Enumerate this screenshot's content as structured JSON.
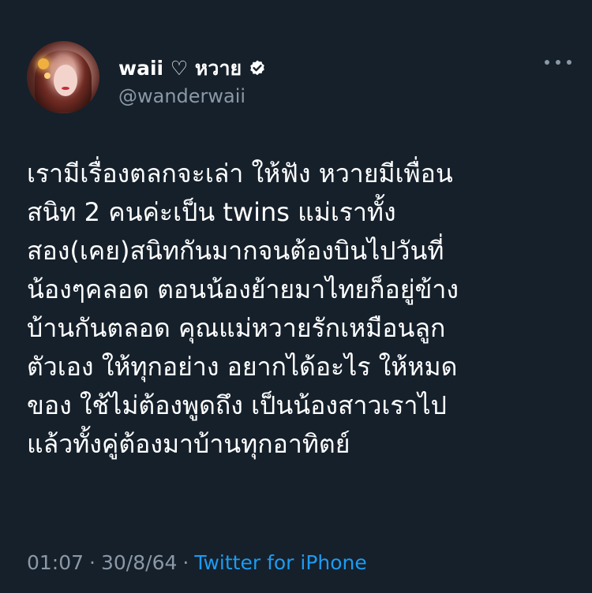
{
  "tweet": {
    "author": {
      "display_name": "waii ♡ หวาย",
      "handle": "@wanderwaii",
      "verified": true,
      "avatar_icon": "profile-photo"
    },
    "more_icon": "more-horizontal-icon",
    "text_lines": [
      "เรามีเรื่องตลกจะเล่า ให้ฟัง หวายมีเพื่อน",
      "สนิท 2 คนค่ะเป็น twins แม่เราทั้ง",
      "สอง(เคย)สนิทกันมากจนต้องบินไปวันที่",
      "น้องๆคลอด ตอนน้องย้ายมาไทยก็อยู่ข้าง",
      "บ้านกันตลอด คุณแม่หวายรักเหมือนลูก",
      "ตัวเอง ให้ทุกอย่าง อยากได้อะไร ให้หมด",
      "ของ ใช้ไม่ต้องพูดถึง เป็นน้องสาวเราไป",
      "แล้วทั้งคู่ต้องมาบ้านทุกอาทิตย์"
    ],
    "time": "01:07",
    "separator": "·",
    "date": "30/8/64",
    "source": "Twitter for iPhone"
  },
  "colors": {
    "background": "#15202b",
    "text": "#ffffff",
    "secondary": "#8b98a5",
    "link": "#1d9bf0"
  }
}
